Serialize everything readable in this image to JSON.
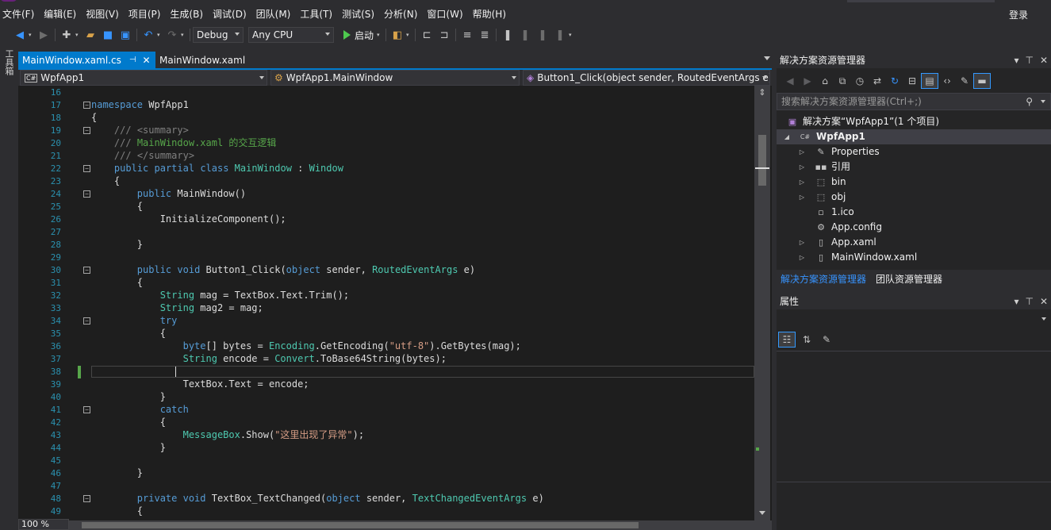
{
  "menu": {
    "items": [
      "文件(F)",
      "编辑(E)",
      "视图(V)",
      "项目(P)",
      "生成(B)",
      "调试(D)",
      "团队(M)",
      "工具(T)",
      "测试(S)",
      "分析(N)",
      "窗口(W)",
      "帮助(H)"
    ],
    "login": "登录"
  },
  "toolbar": {
    "configuration": "Debug",
    "platform": "Any CPU",
    "start_label": "启动",
    "icons": [
      "back-icon",
      "forward-icon",
      "new-project-icon",
      "open-icon",
      "save-icon",
      "save-all-icon",
      "undo-icon",
      "redo-icon",
      "find-icon",
      "step-icon",
      "bookmark-icon"
    ]
  },
  "toolbox": {
    "label": "工具箱"
  },
  "editor": {
    "tabs": [
      {
        "label": "MainWindow.xaml.cs",
        "pin": "⊣",
        "close": "✕"
      },
      {
        "label": "MainWindow.xaml"
      }
    ],
    "nav": {
      "project": "WpfApp1",
      "type": "WpfApp1.MainWindow",
      "member": "Button1_Click(object sender, RoutedEventArgs e)",
      "cs_badge": "C#"
    },
    "zoom": "100 %",
    "lines": [
      {
        "n": "16",
        "fold": "",
        "code": ""
      },
      {
        "n": "17",
        "fold": "−",
        "code": "<span class=\"kw\">namespace</span> WpfApp1"
      },
      {
        "n": "18",
        "fold": "",
        "code": "{"
      },
      {
        "n": "19",
        "fold": "−",
        "code": "    <span class=\"xml\">///</span> <span class=\"xml\">&lt;summary&gt;</span>"
      },
      {
        "n": "20",
        "fold": "",
        "code": "    <span class=\"xml\">///</span> <span class=\"cm\">MainWindow.xaml 的交互逻辑</span>"
      },
      {
        "n": "21",
        "fold": "",
        "code": "    <span class=\"xml\">///</span> <span class=\"xml\">&lt;/summary&gt;</span>"
      },
      {
        "n": "22",
        "fold": "−",
        "code": "    <span class=\"kw\">public</span> <span class=\"kw\">partial</span> <span class=\"kw\">class</span> <span class=\"ty\">MainWindow</span> : <span class=\"ty\">Window</span>"
      },
      {
        "n": "23",
        "fold": "",
        "code": "    {"
      },
      {
        "n": "24",
        "fold": "−",
        "code": "        <span class=\"kw\">public</span> MainWindow()"
      },
      {
        "n": "25",
        "fold": "",
        "code": "        {"
      },
      {
        "n": "26",
        "fold": "",
        "code": "            InitializeComponent();"
      },
      {
        "n": "27",
        "fold": "",
        "code": ""
      },
      {
        "n": "28",
        "fold": "",
        "code": "        }"
      },
      {
        "n": "29",
        "fold": "",
        "code": ""
      },
      {
        "n": "30",
        "fold": "−",
        "code": "        <span class=\"kw\">public</span> <span class=\"kw\">void</span> Button1_Click(<span class=\"kw\">object</span> sender, <span class=\"ty\">RoutedEventArgs</span> e)"
      },
      {
        "n": "31",
        "fold": "",
        "code": "        {"
      },
      {
        "n": "32",
        "fold": "",
        "code": "            <span class=\"ty\">String</span> mag = TextBox.Text.Trim();"
      },
      {
        "n": "33",
        "fold": "",
        "code": "            <span class=\"ty\">String</span> mag2 = mag;"
      },
      {
        "n": "34",
        "fold": "−",
        "code": "            <span class=\"kw\">try</span>"
      },
      {
        "n": "35",
        "fold": "",
        "code": "            {"
      },
      {
        "n": "36",
        "fold": "",
        "code": "                <span class=\"kw\">byte</span>[] bytes = <span class=\"ty\">Encoding</span>.GetEncoding(<span class=\"st\">\"utf-8\"</span>).GetBytes(mag);"
      },
      {
        "n": "37",
        "fold": "",
        "code": "                <span class=\"ty\">String</span> encode = <span class=\"ty\">Convert</span>.ToBase64String(bytes);"
      },
      {
        "n": "38",
        "fold": "",
        "code": ""
      },
      {
        "n": "39",
        "fold": "",
        "code": "                TextBox.Text = encode;"
      },
      {
        "n": "40",
        "fold": "",
        "code": "            }"
      },
      {
        "n": "41",
        "fold": "−",
        "code": "            <span class=\"kw\">catch</span>"
      },
      {
        "n": "42",
        "fold": "",
        "code": "            {"
      },
      {
        "n": "43",
        "fold": "",
        "code": "                <span class=\"ty\">MessageBox</span>.Show(<span class=\"st\">\"这里出现了异常\"</span>);"
      },
      {
        "n": "44",
        "fold": "",
        "code": "            }"
      },
      {
        "n": "45",
        "fold": "",
        "code": ""
      },
      {
        "n": "46",
        "fold": "",
        "code": "        }"
      },
      {
        "n": "47",
        "fold": "",
        "code": ""
      },
      {
        "n": "48",
        "fold": "−",
        "code": "        <span class=\"kw\">private</span> <span class=\"kw\">void</span> TextBox_TextChanged(<span class=\"kw\">object</span> sender, <span class=\"ty\">TextChangedEventArgs</span> e)"
      },
      {
        "n": "49",
        "fold": "",
        "code": "        {"
      }
    ]
  },
  "solution_explorer": {
    "title": "解决方案资源管理器",
    "search_placeholder": "搜索解决方案资源管理器(Ctrl+;)",
    "solution_label": "解决方案“WpfApp1”(1 个项目)",
    "project": "WpfApp1",
    "items": [
      {
        "label": "Properties",
        "icon": "wrench-icon",
        "expandable": true
      },
      {
        "label": "引用",
        "icon": "references-icon",
        "expandable": true
      },
      {
        "label": "bin",
        "icon": "folder-icon",
        "expandable": true
      },
      {
        "label": "obj",
        "icon": "folder-icon",
        "expandable": true
      },
      {
        "label": "1.ico",
        "icon": "file-icon",
        "expandable": false
      },
      {
        "label": "App.config",
        "icon": "config-icon",
        "expandable": false
      },
      {
        "label": "App.xaml",
        "icon": "xaml-icon",
        "expandable": true
      },
      {
        "label": "MainWindow.xaml",
        "icon": "xaml-icon",
        "expandable": true
      }
    ],
    "bottom_tabs": [
      "解决方案资源管理器",
      "团队资源管理器"
    ]
  },
  "properties": {
    "title": "属性"
  },
  "colors": {
    "accent": "#007acc",
    "background": "#1e1e1e",
    "chrome": "#2d2d30"
  }
}
